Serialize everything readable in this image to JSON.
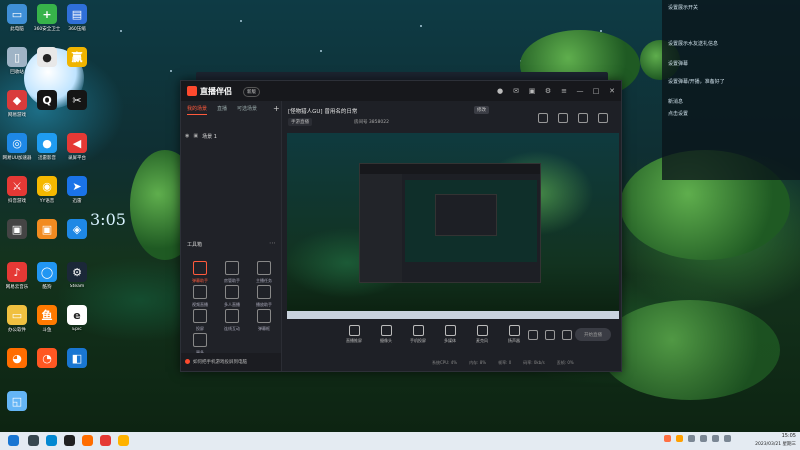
{
  "desktop": {
    "icons": [
      {
        "label": "此电脑",
        "color": "#3f8fd6",
        "glyph": "▭"
      },
      {
        "label": "360安全卫士",
        "color": "#37b34a",
        "glyph": "+"
      },
      {
        "label": "360压缩",
        "color": "#2f6fd8",
        "glyph": "▤"
      },
      {
        "label": "回收站",
        "color": "#9fb4c6",
        "glyph": "▯"
      },
      {
        "label": "",
        "color": "#e8e8e8",
        "glyph": "●"
      },
      {
        "label": "",
        "color": "#f0b400",
        "glyph": "赢"
      },
      {
        "label": "网易游戏",
        "color": "#d93b3b",
        "glyph": "◆"
      },
      {
        "label": "",
        "color": "#151515",
        "glyph": "Q"
      },
      {
        "label": "",
        "color": "#151515",
        "glyph": "✂"
      },
      {
        "label": "网易UU加速器",
        "color": "#1e88e5",
        "glyph": "◎"
      },
      {
        "label": "迅雷影音",
        "color": "#1f9cf0",
        "glyph": "●"
      },
      {
        "label": "录屏平台",
        "color": "#e53935",
        "glyph": "◀"
      },
      {
        "label": "抖音游戏",
        "color": "#e53935",
        "glyph": "⚔"
      },
      {
        "label": "YY语音",
        "color": "#f5b800",
        "glyph": "◉"
      },
      {
        "label": "迅雷",
        "color": "#1a73e8",
        "glyph": "➤"
      },
      {
        "label": "",
        "color": "#444",
        "glyph": "▣"
      },
      {
        "label": "",
        "color": "#f28b20",
        "glyph": "▣"
      },
      {
        "label": "",
        "color": "#1e88e5",
        "glyph": "◈"
      },
      {
        "label": "网易云音乐",
        "color": "#e53935",
        "glyph": "♪"
      },
      {
        "label": "酷狗",
        "color": "#2196f3",
        "glyph": "◯"
      },
      {
        "label": "Steam",
        "color": "#1b2838",
        "glyph": "⚙"
      },
      {
        "label": "办公软件",
        "color": "#f0c040",
        "glyph": "▭"
      },
      {
        "label": "斗鱼",
        "color": "#ff7a00",
        "glyph": "鱼"
      },
      {
        "label": "Epic",
        "color": "#ffffff",
        "glyph": "e"
      },
      {
        "label": "",
        "color": "#ff6d00",
        "glyph": "◕"
      },
      {
        "label": "",
        "color": "#ff5722",
        "glyph": "◔"
      },
      {
        "label": "",
        "color": "#1976d2",
        "glyph": "◧"
      },
      {
        "label": "",
        "color": "#64b5f6",
        "glyph": "◱"
      }
    ],
    "clock_text": "3:05"
  },
  "notify": {
    "rows": [
      "设置展示开关",
      "设置展示水友送礼信息",
      "设置弹幕",
      "设置弹幕/开播，准备好了",
      "新消息",
      "点击设置"
    ]
  },
  "app": {
    "name": "直播伴侣",
    "version": "新版",
    "tabs": [
      "我的场景",
      "直播",
      "可选场景"
    ],
    "scene_name": "场景 1",
    "toolbox_title": "工具箱",
    "tools": [
      "弹幕助手",
      "房管助手",
      "主播任务",
      "视频直播",
      "多人直播",
      "播放助手",
      "投屏",
      "连线互动",
      "弹幕框",
      "更多"
    ],
    "hint": "如何把手机游戏投屏到电脑",
    "live_title": "[怪物猎人GU] 曾用名的日常",
    "edit_label": "修改",
    "category": "手游直播",
    "room_id": "房间号 3858022",
    "controls": [
      "直播推屏",
      "摄像头",
      "手机投屏",
      "多媒体",
      "麦克风",
      "扬声器"
    ],
    "start_label": "开始直播",
    "status": [
      "系统CPU: 4%",
      "内存: 8%",
      "帧率: 0",
      "码率: 0kb/s",
      "丢帧: 0%"
    ]
  },
  "taskbar": {
    "time": "15:05",
    "date": "2023/03/21 星期三"
  }
}
